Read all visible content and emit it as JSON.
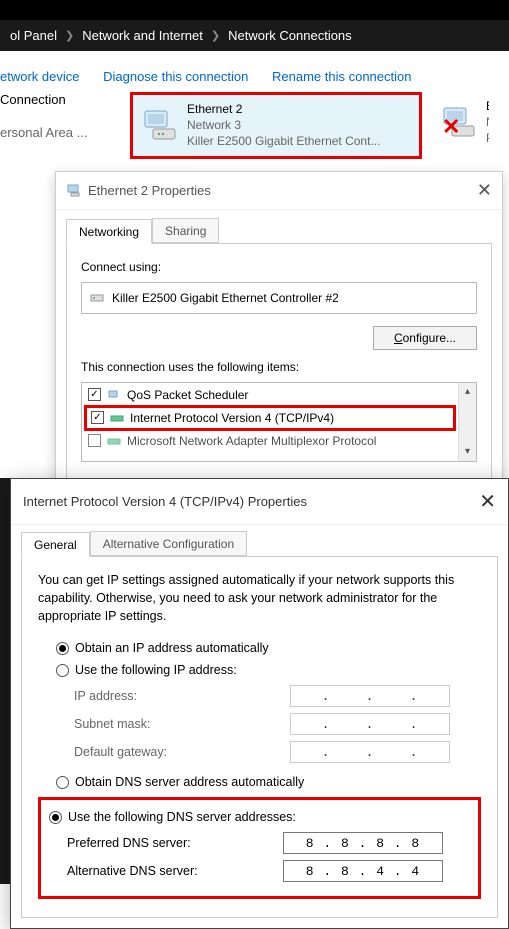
{
  "breadcrumb": {
    "item1": "ol Panel",
    "item2": "Network and Internet",
    "item3": "Network Connections"
  },
  "actions": {
    "link1": "etwork device",
    "link2": "Diagnose this connection",
    "link3": "Rename this connection"
  },
  "adapters": {
    "left_line1": "Connection",
    "left_line2": "ersonal Area ...",
    "main": {
      "name": "Ethernet 2",
      "network": "Network 3",
      "device": "Killer E2500 Gigabit Ethernet Cont..."
    },
    "cutoff": {
      "l1": "E",
      "l2": "N",
      "l3": "P"
    }
  },
  "properties_dialog": {
    "title": "Ethernet 2 Properties",
    "tabs": {
      "t1": "Networking",
      "t2": "Sharing"
    },
    "connect_using_label": "Connect using:",
    "nic": "Killer E2500 Gigabit Ethernet Controller #2",
    "configure_btn": "Configure...",
    "items_label": "This connection uses the following items:",
    "items": {
      "i1": "QoS Packet Scheduler",
      "i2": "Internet Protocol Version 4 (TCP/IPv4)",
      "i3": "Microsoft Network Adapter Multiplexor Protocol"
    }
  },
  "ipv4_dialog": {
    "title": "Internet Protocol Version 4 (TCP/IPv4) Properties",
    "tabs": {
      "t1": "General",
      "t2": "Alternative Configuration"
    },
    "desc": "You can get IP settings assigned automatically if your network supports this capability. Otherwise, you need to ask your network administrator for the appropriate IP settings.",
    "ip_auto": "Obtain an IP address automatically",
    "ip_manual": "Use the following IP address:",
    "ip_label": "IP address:",
    "subnet_label": "Subnet mask:",
    "gateway_label": "Default gateway:",
    "dns_auto": "Obtain DNS server address automatically",
    "dns_manual": "Use the following DNS server addresses:",
    "pref_dns_label": "Preferred DNS server:",
    "alt_dns_label": "Alternative DNS server:",
    "pref_dns_value": "8  .  8  .  8  .  8",
    "alt_dns_value": "8  .  8  .  4  .  4"
  }
}
